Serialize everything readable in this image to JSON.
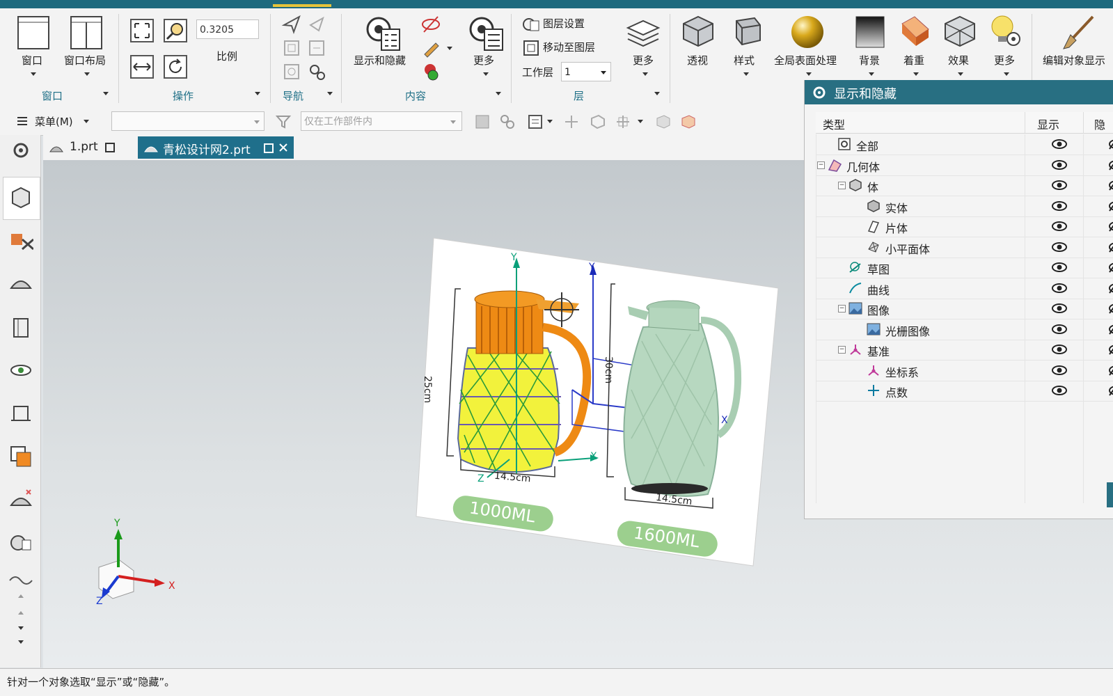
{
  "ribbon": {
    "window_group": {
      "title": "窗口",
      "btn_window": "窗口",
      "btn_layout": "窗口布局"
    },
    "ops_group": {
      "title": "操作",
      "scale_value": "0.3205",
      "scale_label": "比例"
    },
    "nav_group": {
      "title": "导航"
    },
    "content_group": {
      "title": "内容",
      "show_hide": "显示和隐藏",
      "more": "更多"
    },
    "layer_group": {
      "title": "层",
      "layer_settings": "图层设置",
      "move_to_layer": "移动至图层",
      "work_layer_label": "工作层",
      "work_layer_value": "1",
      "more": "更多"
    },
    "visual_group": {
      "perspective": "透视",
      "style": "样式",
      "global_shading": "全局表面处理",
      "background": "背景",
      "color": "着重",
      "effects": "效果",
      "more": "更多",
      "edit_display": "编辑对象显示"
    }
  },
  "toolbar": {
    "menu_label": "菜单(M)",
    "filter_placeholder": "仅在工作部件内"
  },
  "tabs": [
    {
      "label": "1.prt"
    },
    {
      "label": "青松设计网2.prt"
    }
  ],
  "image": {
    "label_small": "1000ML",
    "label_large": "1600ML",
    "dim_h_small": "25cm",
    "dim_h_large": "30cm",
    "dim_w_small": "14.5cm",
    "dim_w_large": "14.5cm",
    "axis_y": "Y",
    "axis_x": "X",
    "axis_z": "Z"
  },
  "panel": {
    "title": "显示和隐藏",
    "col_type": "类型",
    "col_show": "显示",
    "col_hide": "隐",
    "rows": [
      {
        "label": "全部"
      },
      {
        "label": "几何体"
      },
      {
        "label": "体"
      },
      {
        "label": "实体"
      },
      {
        "label": "片体"
      },
      {
        "label": "小平面体"
      },
      {
        "label": "草图"
      },
      {
        "label": "曲线"
      },
      {
        "label": "图像"
      },
      {
        "label": "光栅图像"
      },
      {
        "label": "基准"
      },
      {
        "label": "坐标系"
      },
      {
        "label": "点数"
      }
    ]
  },
  "triad": {
    "x": "X",
    "y": "Y",
    "z": "Z"
  },
  "status": {
    "message": "针对一个对象选取“显示”或“隐藏”。"
  },
  "colors": {
    "accent": "#286f82",
    "teal_strip": "#1f6a7e",
    "highlight": "#e6c43a",
    "active_tab": "#1f6f8b"
  }
}
